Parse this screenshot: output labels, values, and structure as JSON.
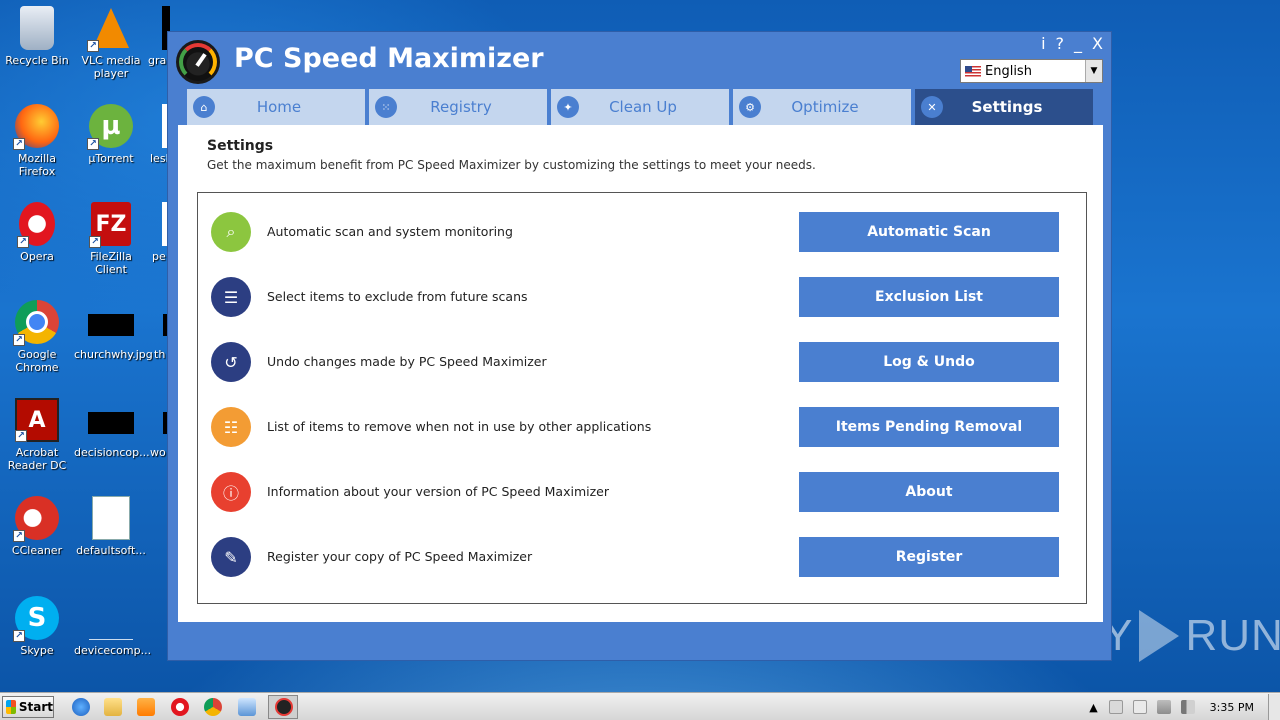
{
  "desktop": {
    "icons": [
      {
        "label": "Recycle Bin",
        "icon": "recycle-bin-icon"
      },
      {
        "label": "VLC media player",
        "icon": "vlc-icon"
      },
      {
        "label": "gra",
        "icon": "file-icon"
      },
      {
        "label": "Mozilla Firefox",
        "icon": "firefox-icon"
      },
      {
        "label": "µTorrent",
        "icon": "utorrent-icon"
      },
      {
        "label": "lesl",
        "icon": "file-icon"
      },
      {
        "label": "Opera",
        "icon": "opera-icon"
      },
      {
        "label": "FileZilla Client",
        "icon": "filezilla-icon"
      },
      {
        "label": "pe",
        "icon": "file-icon"
      },
      {
        "label": "Google Chrome",
        "icon": "chrome-icon"
      },
      {
        "label": "churchwhy.jpg",
        "icon": "image-file-icon"
      },
      {
        "label": "th",
        "icon": "file-icon"
      },
      {
        "label": "Acrobat Reader DC",
        "icon": "acrobat-icon"
      },
      {
        "label": "decisioncop...",
        "icon": "image-file-icon"
      },
      {
        "label": "wo",
        "icon": "file-icon"
      },
      {
        "label": "CCleaner",
        "icon": "ccleaner-icon"
      },
      {
        "label": "defaultsoft...",
        "icon": "word-doc-icon"
      },
      {
        "label": "Skype",
        "icon": "skype-icon"
      },
      {
        "label": "devicecomp...",
        "icon": "file-icon"
      }
    ]
  },
  "app": {
    "title": "PC Speed Maximizer",
    "window_controls": {
      "info": "i",
      "help": "?",
      "minimize": "_",
      "close": "X"
    },
    "language": {
      "selected": "English",
      "flag": "us-flag-icon"
    },
    "tabs": [
      {
        "label": "Home",
        "icon": "home-icon",
        "active": false
      },
      {
        "label": "Registry",
        "icon": "registry-icon",
        "active": false
      },
      {
        "label": "Clean Up",
        "icon": "broom-icon",
        "active": false
      },
      {
        "label": "Optimize",
        "icon": "gear-icon",
        "active": false
      },
      {
        "label": "Settings",
        "icon": "tools-icon",
        "active": true
      }
    ],
    "settings": {
      "heading": "Settings",
      "subtitle": "Get the maximum benefit from PC Speed Maximizer by customizing the settings to meet your needs.",
      "rows": [
        {
          "text": "Automatic scan and system monitoring",
          "button": "Automatic Scan",
          "icon": "search-icon",
          "color": "#8cc63f"
        },
        {
          "text": "Select items to exclude from future scans",
          "button": "Exclusion List",
          "icon": "list-icon",
          "color": "#2c3e82"
        },
        {
          "text": "Undo changes made by PC Speed Maximizer",
          "button": "Log & Undo",
          "icon": "undo-icon",
          "color": "#2c3e82"
        },
        {
          "text": "List of items to remove when not in use by other applications",
          "button": "Items Pending Removal",
          "icon": "pending-list-icon",
          "color": "#f39c34"
        },
        {
          "text": "Information about your version of PC Speed Maximizer",
          "button": "About",
          "icon": "info-icon",
          "color": "#e8402f"
        },
        {
          "text": "Register your copy of PC Speed Maximizer",
          "button": "Register",
          "icon": "register-icon",
          "color": "#2c3e82"
        }
      ]
    }
  },
  "taskbar": {
    "start_label": "Start",
    "clock": "3:35 PM"
  },
  "watermark": {
    "text_left": "ANY",
    "text_right": "RUN"
  },
  "colors": {
    "accent": "#4a7fd0",
    "active_tab": "#2c4f8c",
    "tab_bg": "#c4d6ee"
  }
}
